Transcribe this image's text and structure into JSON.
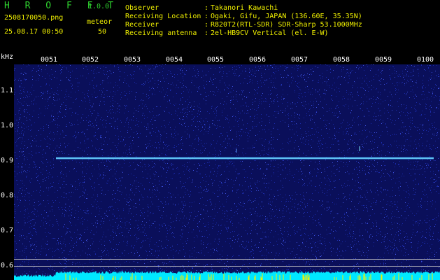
{
  "app": {
    "title": "H R O F F T",
    "version": "1.0.0",
    "filename": "2508170050.png",
    "datetime": "25.08.17 00:50",
    "meteor_label": "meteor",
    "meteor_count": "50"
  },
  "info": [
    {
      "label": "Observer",
      "sep": ":",
      "value": "Takanori Kawachi"
    },
    {
      "label": "Receiving Location",
      "sep": ":",
      "value": "Ogaki, Gifu, JAPAN (136.60E, 35.35N)"
    },
    {
      "label": "Receiver",
      "sep": ":",
      "value": "R820T2(RTL-SDR) SDR-Sharp 53.1000MHz"
    },
    {
      "label": "Receiving antenna",
      "sep": ":",
      "value": "2el-HB9CV Vertical (el. E-W)"
    }
  ],
  "axis": {
    "unit": "kHz",
    "x_ticks": [
      "0051",
      "0052",
      "0053",
      "0054",
      "0055",
      "0056",
      "0057",
      "0058",
      "0059",
      "0100"
    ],
    "y_ticks": [
      "1.1",
      "1.0",
      "0.9",
      "0.8",
      "0.7",
      "0.6"
    ]
  },
  "colors": {
    "background": "#000000",
    "header_green": "#2fd22f",
    "header_yellow": "#f0f000",
    "noise_blue": "#1a2aa8",
    "carrier": "#7fe8ff",
    "power_cyan": "#00e8ff"
  }
}
